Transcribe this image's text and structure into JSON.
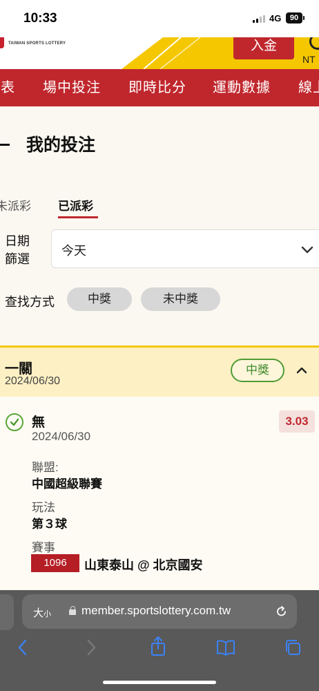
{
  "status_bar": {
    "time": "10:33",
    "network": "4G",
    "battery": "90"
  },
  "header": {
    "logo_subtitle": "TAIWAN SPORTS LOTTERY",
    "deposit_label": "入金",
    "currency": "NT"
  },
  "nav": {
    "items": [
      {
        "label": "賽表"
      },
      {
        "label": "場中投注"
      },
      {
        "label": "即時比分"
      },
      {
        "label": "運動數據"
      },
      {
        "label": "線上"
      }
    ]
  },
  "page": {
    "title": "我的投注",
    "tabs": [
      {
        "label": "未派彩",
        "active": false
      },
      {
        "label": "已派彩",
        "active": true
      }
    ],
    "filter": {
      "date_label": "日期\n篩選",
      "date_value": "今天",
      "search_label": "查找方式",
      "options": [
        {
          "label": "中獎"
        },
        {
          "label": "未中獎"
        }
      ]
    }
  },
  "bet": {
    "type": "一關",
    "date": "2024/06/30",
    "status": "中獎",
    "selection": {
      "name": "無",
      "date": "2024/06/30",
      "odds": "3.03",
      "league_label": "聯盟:",
      "league": "中國超級聯賽",
      "market_label": "玩法",
      "market": "第３球",
      "event_label": "賽事",
      "match_no": "1096",
      "match": "山東泰山 @ 北京國安"
    }
  },
  "browser": {
    "text_size_label": "大",
    "text_size_small": "小",
    "url": "member.sportslottery.com.tw"
  },
  "colors": {
    "brand_red": "#c0272d",
    "header_yellow": "#f5c700",
    "win_green": "#4f9a36",
    "card_bg": "#fdf0c4"
  },
  "icons": [
    "signal-icon",
    "battery-icon",
    "chevron-down-icon",
    "chevron-up-icon",
    "check-circle-icon",
    "lock-icon",
    "reload-icon",
    "back-icon",
    "forward-icon",
    "share-icon",
    "bookmarks-icon",
    "tabs-icon"
  ]
}
